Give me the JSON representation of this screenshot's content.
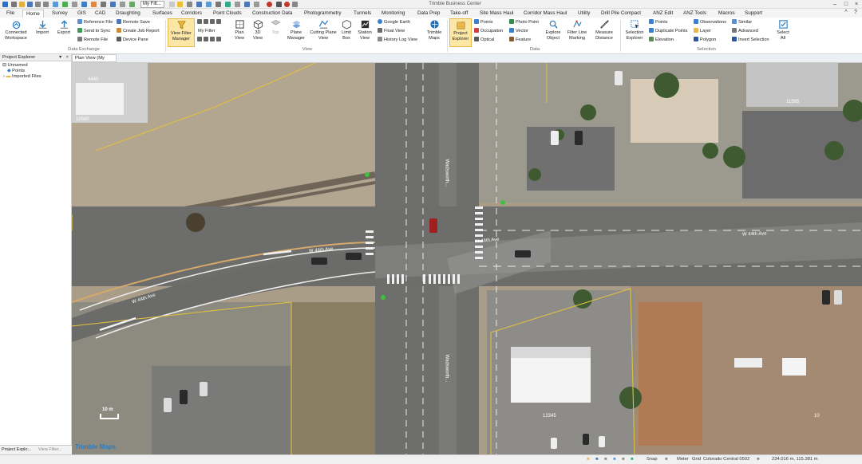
{
  "app": {
    "title": "Trimble Business Center",
    "filter_value": "My Filt..."
  },
  "tabs": [
    "File",
    "Home",
    "Survey",
    "GIS",
    "CAD",
    "Draughting",
    "Surfaces",
    "Corridors",
    "Point Clouds",
    "Construction Data",
    "Photogrammetry",
    "Tunnels",
    "Monitoring",
    "Data Prep",
    "Take-off",
    "Site Mass Haul",
    "Corridor Mass Haul",
    "Utility",
    "Drill Pile Compact",
    "ANZ Edit",
    "ANZ Tools",
    "Macros",
    "Support"
  ],
  "active_tab": "Home",
  "ribbon": {
    "connected_workspace": "Connected Workspace",
    "import": "Import",
    "export": "Export",
    "reference_file": "Reference File",
    "send_to_sync": "Send to Sync",
    "remote_file": "Remote File",
    "remote_save": "Remote Save",
    "create_job_report": "Create Job Report",
    "device_pane": "Device Pane",
    "group_data_exchange": "Data Exchange",
    "view_filter_manager": "View Filter Manager",
    "my_filter": "My Filter",
    "plan_view": "Plan View",
    "view_3d": "3D View",
    "top": "Top",
    "plane_manager": "Plane Manager",
    "cutting_plane_view": "Cutting Plane View",
    "limit_box": "Limit Box",
    "station_view": "Station View",
    "google_earth": "Google Earth",
    "float_view": "Float View",
    "history_log_view": "History Log View",
    "trimble_maps": "Trimble Maps",
    "group_view": "View",
    "project_explorer": "Project Explorer",
    "points": "Points",
    "occupation": "Occupation",
    "optical": "Optical",
    "photo_point": "Photo Point",
    "vector": "Vector",
    "feature": "Feature",
    "explore_object": "Explore Object",
    "filter_line_marking": "Filter Line Marking",
    "measure_distance": "Measure Distance",
    "group_data": "Data",
    "selection_explorer": "Selection Explorer",
    "sel_points": "Points",
    "duplicate_points": "Duplicate Points",
    "elevation": "Elevation",
    "observations": "Observations",
    "layer": "Layer",
    "polygon": "Polygon",
    "similar": "Similar",
    "advanced": "Advanced",
    "invert_selection": "Invert Selection",
    "select_all": "Select All",
    "group_selection": "Selection"
  },
  "panel": {
    "title": "Project Explorer",
    "tree": [
      "Unnamed",
      "Points",
      "Imported Files"
    ],
    "bottom_tabs": [
      "Project Explo...",
      "View Filter..."
    ]
  },
  "view_tab": "Plan View (My Filter)",
  "map": {
    "labels": {
      "w44_left": "W 44th Ave",
      "w44_mid": "W 44th Ave",
      "w44_center": "W 44th Ave",
      "w44_right": "W 44th Ave",
      "wads_north": "Wadsworth...",
      "wads_south": "Wadsworth..."
    },
    "parcels": [
      "4440",
      "10560",
      "12345",
      "11565",
      "10"
    ],
    "logo": "Trimble Maps",
    "scale_label": "10 m"
  },
  "status": {
    "snap": "Snap",
    "units": "Meter",
    "grid": "Grid",
    "coord_system": "Colorado Central 0502",
    "coords": "234.016 m, 115.381 m"
  },
  "colors": {
    "accent": "#2b579a",
    "highlight": "#fde7a6",
    "parcel_line": "#e0c040"
  }
}
